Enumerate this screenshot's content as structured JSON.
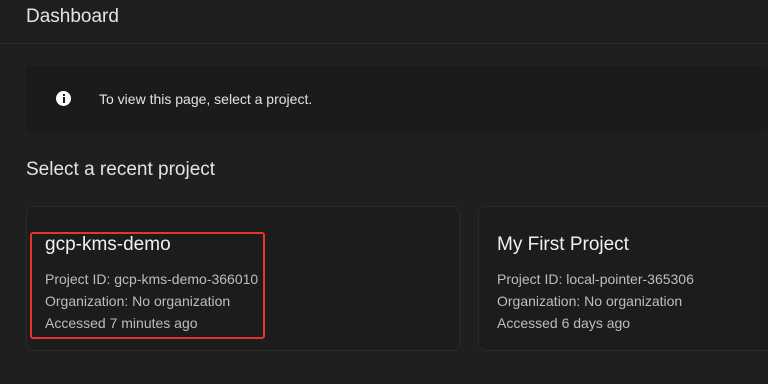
{
  "header": {
    "title": "Dashboard"
  },
  "info_banner": {
    "icon": "info-icon",
    "text": "To view this page, select a project."
  },
  "recent": {
    "title": "Select a recent project",
    "projects": [
      {
        "name": "gcp-kms-demo",
        "project_id_line": "Project ID: gcp-kms-demo-366010",
        "organization_line": "Organization: No organization",
        "accessed_line": "Accessed 7 minutes ago",
        "highlighted": true
      },
      {
        "name": "My First Project",
        "project_id_line": "Project ID: local-pointer-365306",
        "organization_line": "Organization: No organization",
        "accessed_line": "Accessed 6 days ago",
        "highlighted": false
      }
    ]
  },
  "colors": {
    "background": "#1f1f1f",
    "card": "#1c1c1c",
    "highlight": "#e8322c"
  }
}
